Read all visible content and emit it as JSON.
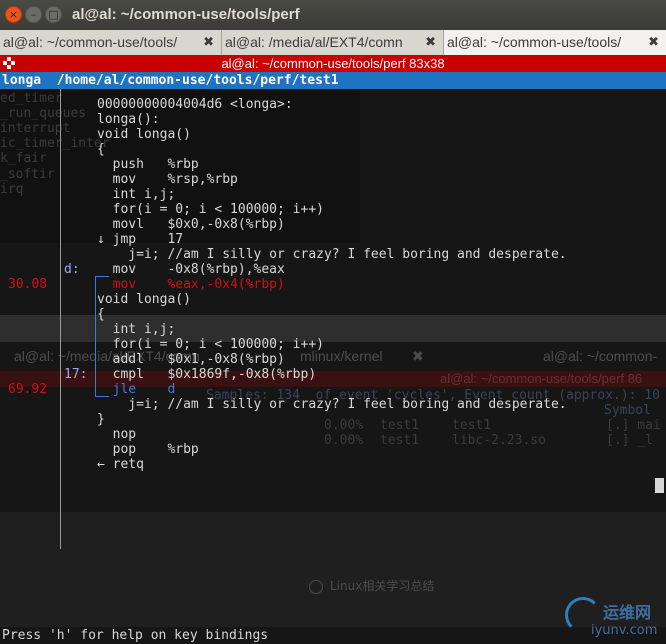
{
  "window": {
    "title": "al@al: ~/common-use/tools/perf",
    "buttons": {
      "close": "×",
      "minimize": "–",
      "maximize": "□"
    }
  },
  "tabs": [
    {
      "label": "al@al: ~/common-use/tools/",
      "close": "✖"
    },
    {
      "label": "al@al: /media/al/EXT4/comn",
      "close": "✖"
    },
    {
      "label": "al@al: ~/common-use/tools/",
      "close": "✖",
      "active": true
    }
  ],
  "terminal": {
    "title_bar": "al@al: ~/common-use/tools/perf 83x38",
    "header": "longa  /home/al/common-use/tools/perf/test1",
    "hint": "Press 'h' for help on key bindings"
  },
  "ghost": {
    "left_lines": [
      "ed_timer",
      "_run_queues",
      "interrupt",
      "ic_timer_inter",
      "k_fair",
      "_softir",
      "irq"
    ],
    "tab_left": "al@al: ~/media/al/EXT4/comn",
    "tab_mid": "mlinux/kernel",
    "tab_close": "✖",
    "tab_right": "al@al: ~/common-",
    "redbar": "al@al: ~/common-use/tools/perf 86",
    "samples": "Samples: 134  of event 'cycles', Event count (approx.): 10",
    "symbol_col": "Symbol",
    "rows": [
      {
        "pct": "0.00%",
        "cmd": "test1",
        "obj": "test1",
        "sym": "[.] mai"
      },
      {
        "pct": "0.00%",
        "cmd": "test1",
        "obj": "libc-2.23.so",
        "sym": "[.] _l"
      }
    ],
    "checkbox_label": "Linux相关学习总结"
  },
  "annotate": {
    "lines": [
      {
        "pct": "",
        "label": "",
        "code": "00000000004004d6 <longa>:"
      },
      {
        "pct": "",
        "label": "",
        "code": "longa():"
      },
      {
        "pct": "",
        "label": "",
        "code": "void longa()"
      },
      {
        "pct": "",
        "label": "",
        "code": "{"
      },
      {
        "pct": "",
        "label": "",
        "code": "  push   %rbp"
      },
      {
        "pct": "",
        "label": "",
        "code": "  mov    %rsp,%rbp"
      },
      {
        "pct": "",
        "label": "",
        "code": "  int i,j;"
      },
      {
        "pct": "",
        "label": "",
        "code": "  for(i = 0; i < 100000; i++)"
      },
      {
        "pct": "",
        "label": "",
        "code": "  movl   $0x0,-0x8(%rbp)"
      },
      {
        "pct": "",
        "label": "",
        "code": "↓ jmp    17",
        "style": "plain"
      },
      {
        "pct": "",
        "label": "",
        "code": "    j=i; //am I silly or crazy? I feel boring and desperate."
      },
      {
        "pct": "",
        "label": "d:",
        "code": "  mov    -0x8(%rbp),%eax",
        "style": "target"
      },
      {
        "pct": "30.08",
        "label": "",
        "code": "  mov    %eax,-0x4(%rbp)",
        "style": "hot"
      },
      {
        "pct": "",
        "label": "",
        "code": "void longa()"
      },
      {
        "pct": "",
        "label": "",
        "code": "{"
      },
      {
        "pct": "",
        "label": "",
        "code": "  int i,j;"
      },
      {
        "pct": "",
        "label": "",
        "code": "  for(i = 0; i < 100000; i++)"
      },
      {
        "pct": "",
        "label": "",
        "code": "  addl   $0x1,-0x8(%rbp)"
      },
      {
        "pct": "",
        "label": "17:",
        "code": "  cmpl   $0x1869f,-0x8(%rbp)"
      },
      {
        "pct": "69.92",
        "label": "",
        "code": "  jle    d",
        "style": "hotblue"
      },
      {
        "pct": "",
        "label": "",
        "code": "    j=i; //am I silly or crazy? I feel boring and desperate."
      },
      {
        "pct": "",
        "label": "",
        "code": "}"
      },
      {
        "pct": "",
        "label": "",
        "code": "  nop"
      },
      {
        "pct": "",
        "label": "",
        "code": "  pop    %rbp"
      },
      {
        "pct": "",
        "label": "",
        "code": "← retq"
      }
    ]
  },
  "watermark": {
    "cn": "运维网",
    "en": "iyunv.com"
  },
  "colors": {
    "hot": "#d01010",
    "jump": "#3b7be0",
    "header": "#1e74c0",
    "red_title": "#c80000"
  }
}
